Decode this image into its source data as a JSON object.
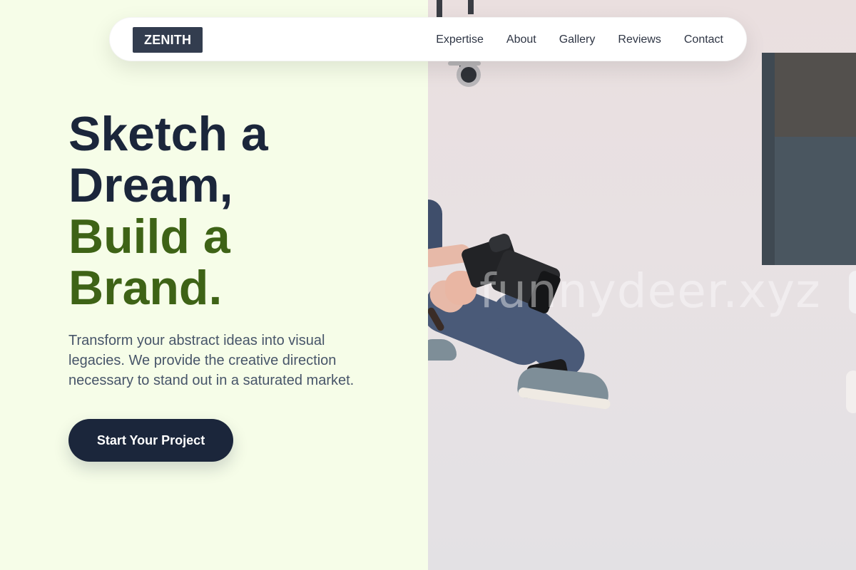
{
  "brand": {
    "logo": "ZENITH"
  },
  "nav": {
    "links": [
      "Expertise",
      "About",
      "Gallery",
      "Reviews",
      "Contact"
    ]
  },
  "hero": {
    "title_line1": "Sketch a",
    "title_line2": "Dream,",
    "title_line3": "Build a",
    "title_line4": "Brand.",
    "description": "Transform your abstract ideas into visual legacies. We provide the creative direction necessary to stand out in a saturated market.",
    "cta_label": "Start Your Project"
  },
  "image": {
    "watermark": "funnydeer.xyz",
    "subject": "photographer-with-camera-in-studio"
  },
  "colors": {
    "background": "#f6fde8",
    "navy": "#1b263b",
    "accent_green": "#3e6316",
    "logo_bg": "#333d4f",
    "text_muted": "#475569"
  }
}
